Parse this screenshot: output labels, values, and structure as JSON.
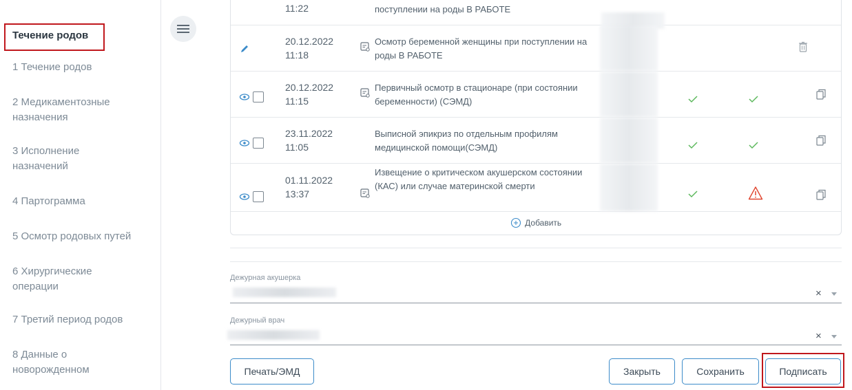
{
  "sidebar": {
    "title": "Течение родов",
    "items": [
      {
        "label": "1 Течение родов"
      },
      {
        "label": "2 Медикаментозные назначения"
      },
      {
        "label": "3 Исполнение назначений"
      },
      {
        "label": "4 Партограмма"
      },
      {
        "label": "5 Осмотр родовых путей"
      },
      {
        "label": "6 Хирургические операции"
      },
      {
        "label": "7 Третий период родов"
      },
      {
        "label": "8 Данные о новорожденном"
      }
    ]
  },
  "table": {
    "partial_row": {
      "time": "11:22",
      "doc": "поступлении на роды В РАБОТЕ"
    },
    "rows": [
      {
        "date": "20.12.2022",
        "time": "11:18",
        "doc": "Осмотр беременной женщины при поступлении на роды В РАБОТЕ",
        "action": "edit-icon",
        "status1": "",
        "status2": "",
        "trailing": "trash-icon"
      },
      {
        "date": "20.12.2022",
        "time": "11:15",
        "doc": "Первичный осмотр в стационаре (при состоянии беременности) (СЭМД)",
        "action": "eye-icon",
        "status1": "check",
        "status2": "check",
        "trailing": "copy-icon"
      },
      {
        "date": "23.11.2022",
        "time": "11:05",
        "doc": "Выписной эпикриз по отдельным профилям медицинской помощи(СЭМД)",
        "action": "eye-icon",
        "status1": "check",
        "status2": "check",
        "trailing": "copy-icon"
      },
      {
        "date": "01.11.2022",
        "time": "13:37",
        "doc": "Извещение о критическом акушерском состоянии (КАС) или случае материнской смерти",
        "action": "eye-icon",
        "status1": "check",
        "status2": "warning",
        "trailing": "copy-icon"
      }
    ],
    "add_label": "Добавить"
  },
  "fields": {
    "midwife_label": "Дежурная акушерка",
    "doctor_label": "Дежурный врач",
    "clear_symbol": "×"
  },
  "buttons": {
    "print": "Печать/ЭМД",
    "close": "Закрыть",
    "save": "Сохранить",
    "sign": "Подписать"
  },
  "colors": {
    "accent_blue": "#3b8bc9",
    "check_green": "#5cb85c",
    "warning_red": "#e0452f",
    "highlight_red": "#c0171c"
  }
}
